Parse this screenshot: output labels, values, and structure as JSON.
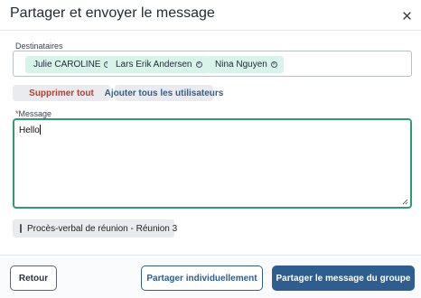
{
  "dialog": {
    "title": "Partager et envoyer le message"
  },
  "recipients": {
    "label": "Destinataires",
    "chips": [
      {
        "name": "Julie CAROLINE"
      },
      {
        "name": "Lars Erik Andersen"
      },
      {
        "name": "Nina Nguyen"
      }
    ]
  },
  "actions": {
    "remove_all": "Supprimer tout",
    "add_all": "Ajouter tous les utilisateurs"
  },
  "message": {
    "required_mark": "*",
    "label": "Message",
    "value": "Hello"
  },
  "attachment": {
    "icon": "document-icon",
    "label": "Procès-verbal de réunion - Réunion 3"
  },
  "footer": {
    "back": "Retour",
    "share_individually": "Partager individuellement",
    "share_group": "Partager le message du groupe"
  },
  "colors": {
    "primary": "#2d5e8f",
    "chip_bg": "#d7f3ea",
    "focus_border": "#2f9a7a",
    "danger": "#c0392b"
  }
}
